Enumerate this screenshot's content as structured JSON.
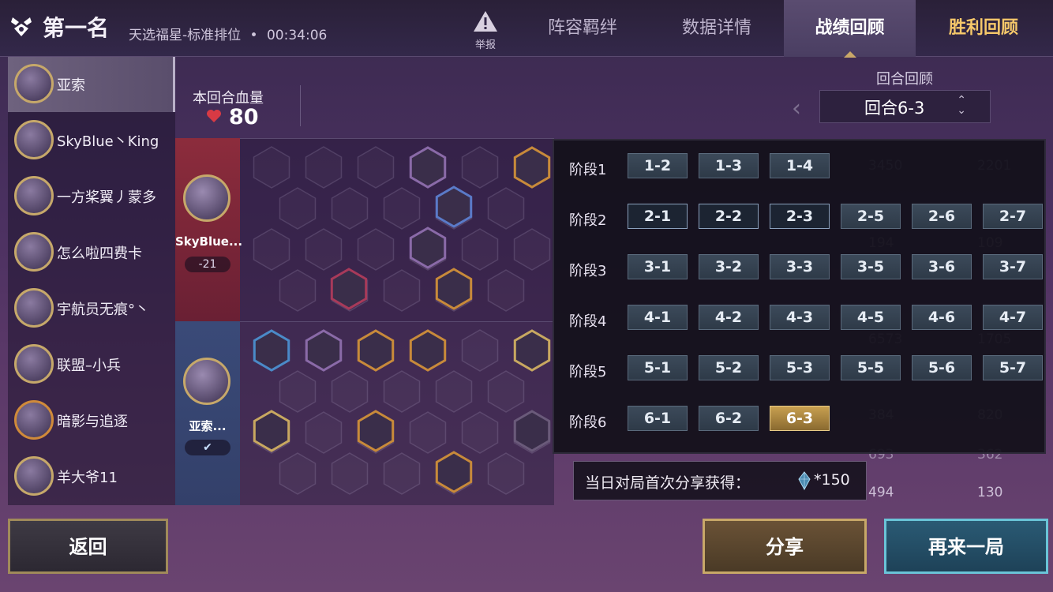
{
  "header": {
    "rank_title": "第一名",
    "mode": "天选福星-标准排位",
    "separator": "•",
    "duration": "00:34:06",
    "report_label": "举报",
    "tabs": [
      {
        "label": "阵容羁绊",
        "state": "normal"
      },
      {
        "label": "数据详情",
        "state": "normal"
      },
      {
        "label": "战绩回顾",
        "state": "active"
      },
      {
        "label": "胜利回顾",
        "state": "highlight"
      }
    ]
  },
  "players": [
    {
      "name": "亚索",
      "selected": true
    },
    {
      "name": "SkyBlue丶King",
      "selected": false
    },
    {
      "name": "一方桨翼丿蒙多",
      "selected": false
    },
    {
      "name": "怎么啦四费卡",
      "selected": false
    },
    {
      "name": "宇航员无痕°丶",
      "selected": false
    },
    {
      "name": "联盟–小兵",
      "selected": false
    },
    {
      "name": "暗影与追逐",
      "selected": false
    },
    {
      "name": "羊大爷11",
      "selected": false
    }
  ],
  "round_hp": {
    "label": "本回合血量",
    "value": "80"
  },
  "round_review": {
    "label": "回合回顾",
    "current": "回合6-3"
  },
  "board": {
    "opponent": {
      "name": "SkyBlue...",
      "delta": "-21"
    },
    "self": {
      "name": "亚索...",
      "status_icon": "check-icon"
    }
  },
  "round_picker": {
    "stages": [
      {
        "label": "阶段1",
        "rounds": [
          "1-2",
          "1-3",
          "1-4"
        ]
      },
      {
        "label": "阶段2",
        "rounds": [
          "2-1",
          "2-2",
          "2-3",
          "2-5",
          "2-6",
          "2-7"
        ]
      },
      {
        "label": "阶段3",
        "rounds": [
          "3-1",
          "3-2",
          "3-3",
          "3-5",
          "3-6",
          "3-7"
        ]
      },
      {
        "label": "阶段4",
        "rounds": [
          "4-1",
          "4-2",
          "4-3",
          "4-5",
          "4-6",
          "4-7"
        ]
      },
      {
        "label": "阶段5",
        "rounds": [
          "5-1",
          "5-2",
          "5-3",
          "5-5",
          "5-6",
          "5-7"
        ]
      },
      {
        "label": "阶段6",
        "rounds": [
          "6-1",
          "6-2",
          "6-3"
        ]
      }
    ],
    "selected": "6-3",
    "pvp_rounds": [
      "2-1",
      "2-2",
      "2-3"
    ]
  },
  "share_tip": {
    "text": "当日对局首次分享获得：",
    "amount": "*150",
    "icon": "gem-icon"
  },
  "ghost_stats": [
    "3450",
    "2201",
    "194",
    "109",
    "6573",
    "1705",
    "384",
    "820",
    "693",
    "362",
    "494",
    "130"
  ],
  "buttons": {
    "back": "返回",
    "share": "分享",
    "again": "再来一局"
  },
  "colors": {
    "accent_gold": "#c8a050",
    "highlight_tab": "#f6c86a",
    "opponent_side": "#8c2c3c",
    "self_side": "#3a4a78",
    "again_border": "#6ac4d8"
  }
}
